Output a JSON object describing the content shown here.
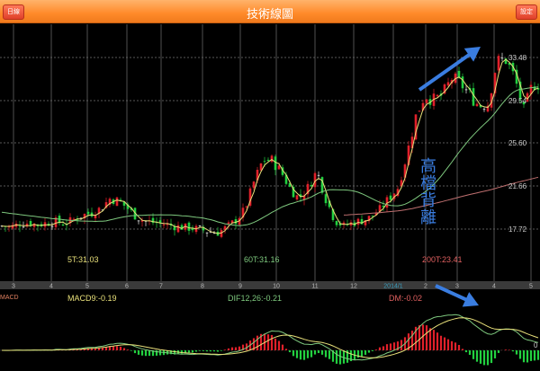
{
  "header": {
    "title": "技術線圖",
    "left_button": "日線",
    "right_button": "設定"
  },
  "colors": {
    "up": "#e0202a",
    "down": "#22d040",
    "doji": "#e8e8e8",
    "ma5": "#e8e07a",
    "ma60": "#7ec87e",
    "ma200": "#c07070",
    "accent": "#ff8a2a",
    "annotation": "#3a7de0"
  },
  "chart_data": {
    "type": "candlestick",
    "x_tick_labels": [
      "3",
      "4",
      "5",
      "6",
      "7",
      "8",
      "9",
      "10",
      "11",
      "12",
      "2014/1",
      "2",
      "3",
      "4",
      "5"
    ],
    "y_tick_labels": [
      "33.48",
      "29.54",
      "25.60",
      "21.66",
      "17.72"
    ],
    "ylim": [
      14.5,
      36.5
    ],
    "grid": true,
    "closes": [
      18.0,
      17.9,
      18.2,
      18.3,
      18.1,
      18.3,
      18.4,
      18.2,
      18.6,
      19.0,
      19.2,
      19.6,
      20.5,
      20.3,
      19.6,
      18.8,
      18.4,
      18.3,
      18.2,
      18.0,
      17.9,
      17.8,
      17.7,
      17.5,
      17.4,
      17.9,
      18.5,
      19.5,
      22.0,
      24.0,
      24.0,
      23.0,
      21.5,
      20.5,
      21.5,
      23.0,
      20.5,
      18.5,
      18.0,
      18.3,
      18.5,
      18.8,
      19.5,
      20.5,
      21.5,
      24.5,
      28.0,
      30.0,
      29.5,
      30.0,
      31.5,
      31.0,
      30.0,
      29.0,
      29.2,
      33.0,
      33.2,
      31.5,
      28.5,
      31.0
    ],
    "ma_legend": {
      "ma5": "5T:31.03",
      "ma60": "60T:31.16",
      "ma200": "200T:23.41"
    },
    "macd_legend": {
      "title": "MACD",
      "macd": "MACD9:-0.19",
      "dif": "DIF12,26:-0.21",
      "dm": "DM:-0.02",
      "zero": "0"
    }
  },
  "annotation": {
    "text": [
      "高",
      "檔",
      "背",
      "離"
    ]
  }
}
